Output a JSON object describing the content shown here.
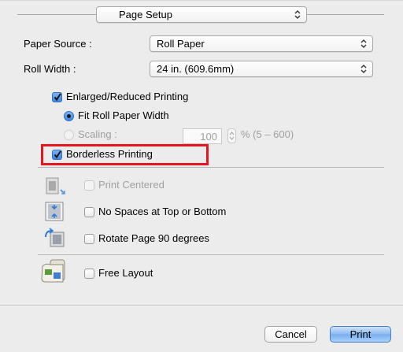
{
  "header": {
    "preset_value": "Page Setup"
  },
  "paper_source": {
    "label": "Paper Source :",
    "value": "Roll Paper"
  },
  "roll_width": {
    "label": "Roll Width :",
    "value": "24 in. (609.6mm)"
  },
  "enlarged": {
    "label": "Enlarged/Reduced Printing",
    "checked": true,
    "fit_roll": {
      "label": "Fit Roll Paper Width",
      "selected": true
    },
    "scaling": {
      "label": "Scaling :",
      "value": "100",
      "range": "% (5 – 600)",
      "enabled": false
    }
  },
  "borderless": {
    "label": "Borderless Printing",
    "checked": true
  },
  "layout_options": [
    {
      "label": "Print Centered",
      "checked": false,
      "enabled": false,
      "icon": "print-centered-icon"
    },
    {
      "label": "No Spaces at Top or Bottom",
      "checked": false,
      "enabled": true,
      "icon": "no-spaces-icon"
    },
    {
      "label": "Rotate Page 90 degrees",
      "checked": false,
      "enabled": true,
      "icon": "rotate-page-icon"
    },
    {
      "label": "Free Layout",
      "checked": false,
      "enabled": true,
      "icon": "free-layout-icon"
    }
  ],
  "buttons": {
    "cancel": "Cancel",
    "print": "Print"
  },
  "colors": {
    "highlight": "#e8141e",
    "accent": "#3a86e2",
    "background": "#ececec"
  }
}
